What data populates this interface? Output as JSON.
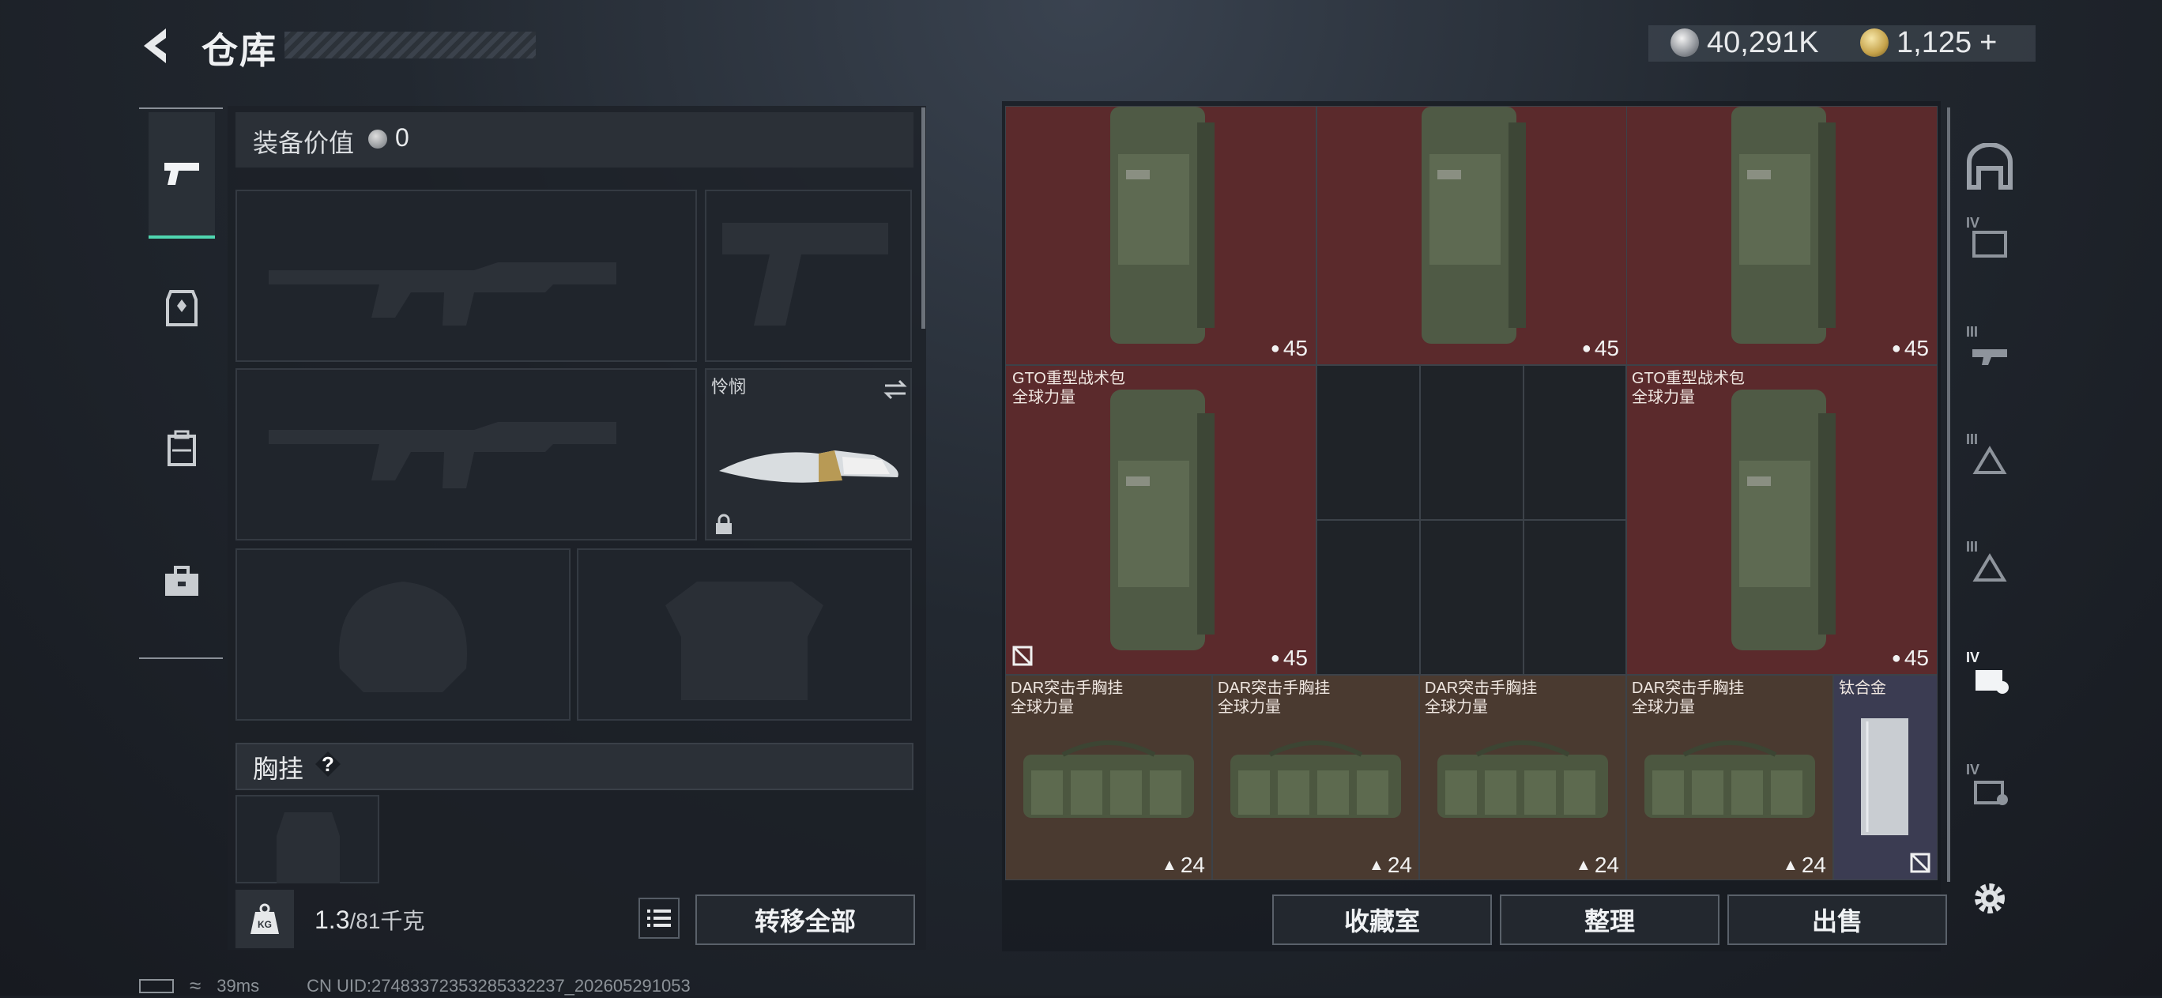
{
  "header": {
    "title": "仓库",
    "silver_amount": "40,291K",
    "gold_amount": "1,125",
    "gold_plus": "+"
  },
  "equipment": {
    "value_label": "装备价值",
    "value": "0",
    "melee_name": "怜悯",
    "vest_label": "胸挂",
    "vest_help": "?",
    "weight_current": "1.3",
    "weight_max": "/81",
    "weight_unit": "千克",
    "kg_label": "KG",
    "transfer_all": "转移全部"
  },
  "nav_icons": [
    "pistol-icon",
    "armor-icon",
    "backpack-icon",
    "toolbox-icon"
  ],
  "stash": {
    "backpack_name": "GTO重型战术包",
    "backpack_source": "全球力量",
    "backpack_count": "45",
    "vest_name": "DAR突击手胸挂",
    "vest_source": "全球力量",
    "vest_count": "24",
    "titanium_name": "钛合金",
    "buttons": {
      "collection": "收藏室",
      "sort": "整理",
      "sell": "出售"
    }
  },
  "side_tabs": [
    "IV",
    "III",
    "III",
    "III",
    "IV",
    "IV"
  ],
  "status": {
    "ping": "39ms",
    "uid": "CN UID:2748337235328533​2237_202605291053"
  }
}
